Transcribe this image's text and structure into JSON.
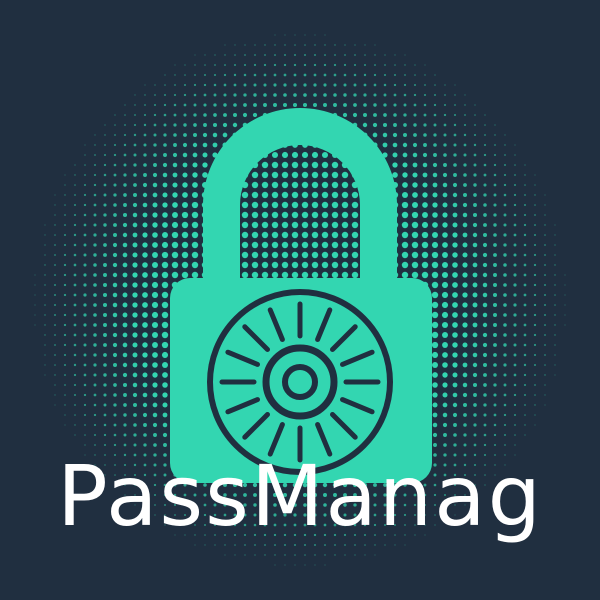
{
  "logo": {
    "wordmark": "PassManag",
    "icon": "padlock-dial-icon"
  },
  "colors": {
    "background": "#202f40",
    "accent": "#33d6b1",
    "text": "#ffffff"
  }
}
